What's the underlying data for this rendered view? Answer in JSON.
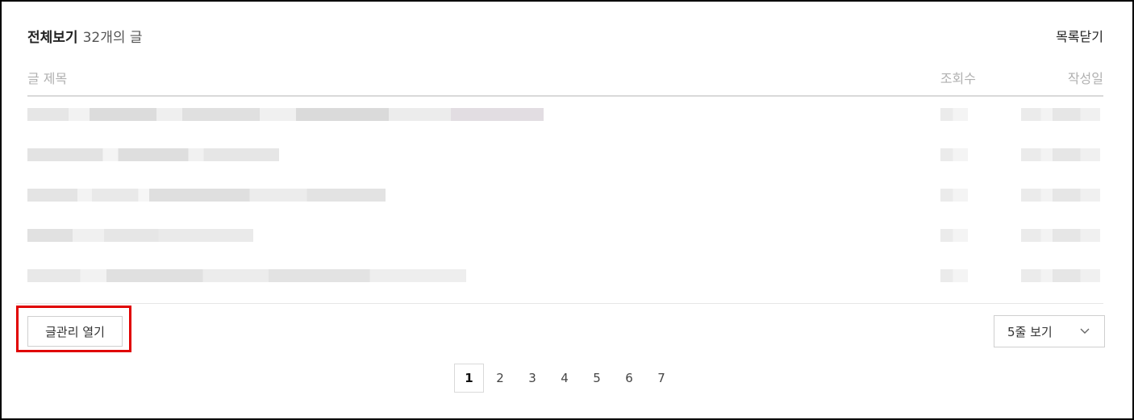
{
  "header": {
    "title": "전체보기",
    "count": "32개의 글",
    "close_label": "목록닫기"
  },
  "columns": {
    "title": "글 제목",
    "views": "조회수",
    "date": "작성일"
  },
  "footer": {
    "manage_button": "글관리 열기",
    "rows_select": "5줄 보기"
  },
  "pagination": {
    "current": "1",
    "pages": [
      "2",
      "3",
      "4",
      "5",
      "6",
      "7"
    ]
  },
  "colors": {
    "highlight": "#e00000"
  }
}
